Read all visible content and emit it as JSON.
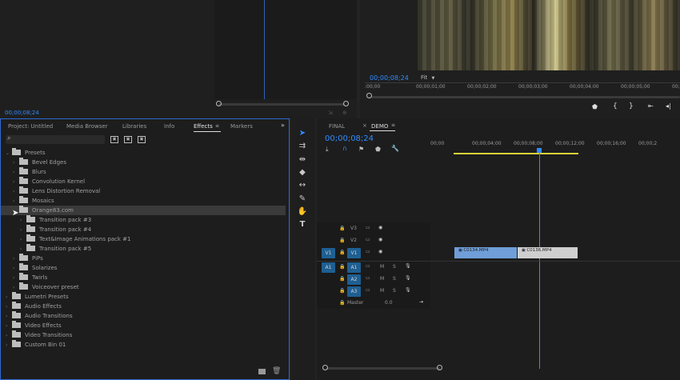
{
  "source_monitor": {
    "timecode": "00;00;08;24"
  },
  "program_monitor": {
    "timecode": "00;00;08;24",
    "fit": "Fit",
    "ruler": [
      ":00;00",
      "00;00;01;00",
      "00;00;02;00",
      "00;00;03;00",
      "00;00;04;00",
      "00;00;05;00",
      "00;00;0"
    ]
  },
  "project_panel": {
    "tabs": [
      "Project: Untitled",
      "Media Browser",
      "Libraries",
      "Info",
      "Effects",
      "Markers"
    ],
    "active_tab": "Effects",
    "tree": [
      {
        "label": "Presets",
        "indent": 0,
        "open": true
      },
      {
        "label": "Bevel Edges",
        "indent": 1
      },
      {
        "label": "Blurs",
        "indent": 1
      },
      {
        "label": "Convolution Kernel",
        "indent": 1
      },
      {
        "label": "Lens Distortion Removal",
        "indent": 1
      },
      {
        "label": "Mosaics",
        "indent": 1
      },
      {
        "label": "Orange83.com",
        "indent": 1,
        "open": true,
        "highlight": true
      },
      {
        "label": "Transition pack #3",
        "indent": 2
      },
      {
        "label": "Transition pack #4",
        "indent": 2
      },
      {
        "label": "Text&Image Animations pack #1",
        "indent": 2
      },
      {
        "label": "Transition pack #5",
        "indent": 2
      },
      {
        "label": "PiPs",
        "indent": 1
      },
      {
        "label": "Solarizes",
        "indent": 1
      },
      {
        "label": "Twirls",
        "indent": 1
      },
      {
        "label": "Voiceover preset",
        "indent": 1
      },
      {
        "label": "Lumetri Presets",
        "indent": 0
      },
      {
        "label": "Audio Effects",
        "indent": 0
      },
      {
        "label": "Audio Transitions",
        "indent": 0
      },
      {
        "label": "Video Effects",
        "indent": 0
      },
      {
        "label": "Video Transitions",
        "indent": 0
      },
      {
        "label": "Custom Bin 01",
        "indent": 0
      }
    ]
  },
  "timeline": {
    "tabs": [
      "FINAL",
      "DEMO"
    ],
    "active_tab": "DEMO",
    "timecode": "00;00;08;24",
    "ruler": [
      "00;00",
      "00;00;04;00",
      "00;00;08;00",
      "00;00;12;00",
      "00;00;16;00",
      "00;00;2"
    ],
    "video_tracks": [
      "V3",
      "V2",
      "V1"
    ],
    "audio_tracks": [
      "A1",
      "A2",
      "A3"
    ],
    "source_patch": {
      "video": "V1",
      "audio": "A1"
    },
    "master_label": "Master",
    "master_value": "0.0",
    "clips": [
      "C0134.MP4",
      "C0136.MP4"
    ],
    "mute": "M",
    "solo": "S"
  },
  "colors": {
    "accent": "#2f8cff",
    "clip_blue": "#6f9ed8",
    "clip_gray": "#cfcfcf"
  }
}
